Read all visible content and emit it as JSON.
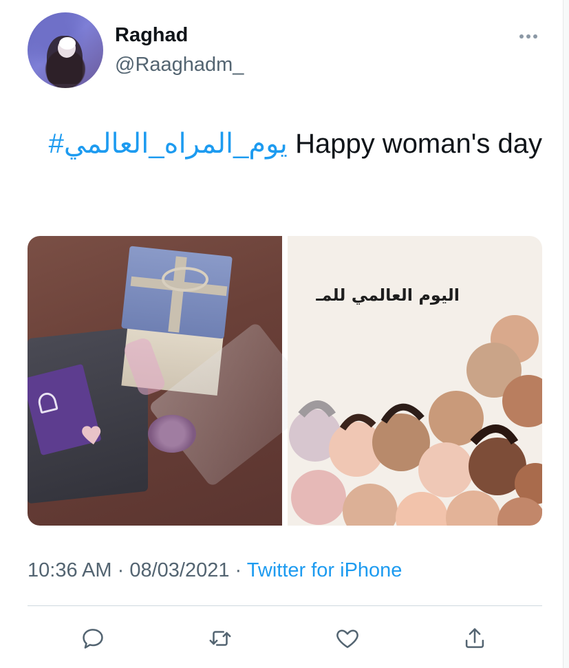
{
  "user": {
    "name": "Raghad",
    "handle": "@Raaghadm_"
  },
  "tweet": {
    "hashtag": "#يوم_المراه_العالمي",
    "text": "Happy woman's day"
  },
  "media": {
    "right_image_caption": "اليوم العالمي للمـ"
  },
  "meta": {
    "time": "10:36 AM",
    "separator1": "·",
    "date": "08/03/2021",
    "separator2": "·",
    "source": "Twitter for iPhone"
  },
  "icons": {
    "more": "more-dots-icon",
    "reply": "reply-icon",
    "retweet": "retweet-icon",
    "like": "heart-icon",
    "share": "share-icon"
  },
  "colors": {
    "accent": "#1d9bf0",
    "secondary_text": "#536471",
    "primary_text": "#0f1419"
  }
}
